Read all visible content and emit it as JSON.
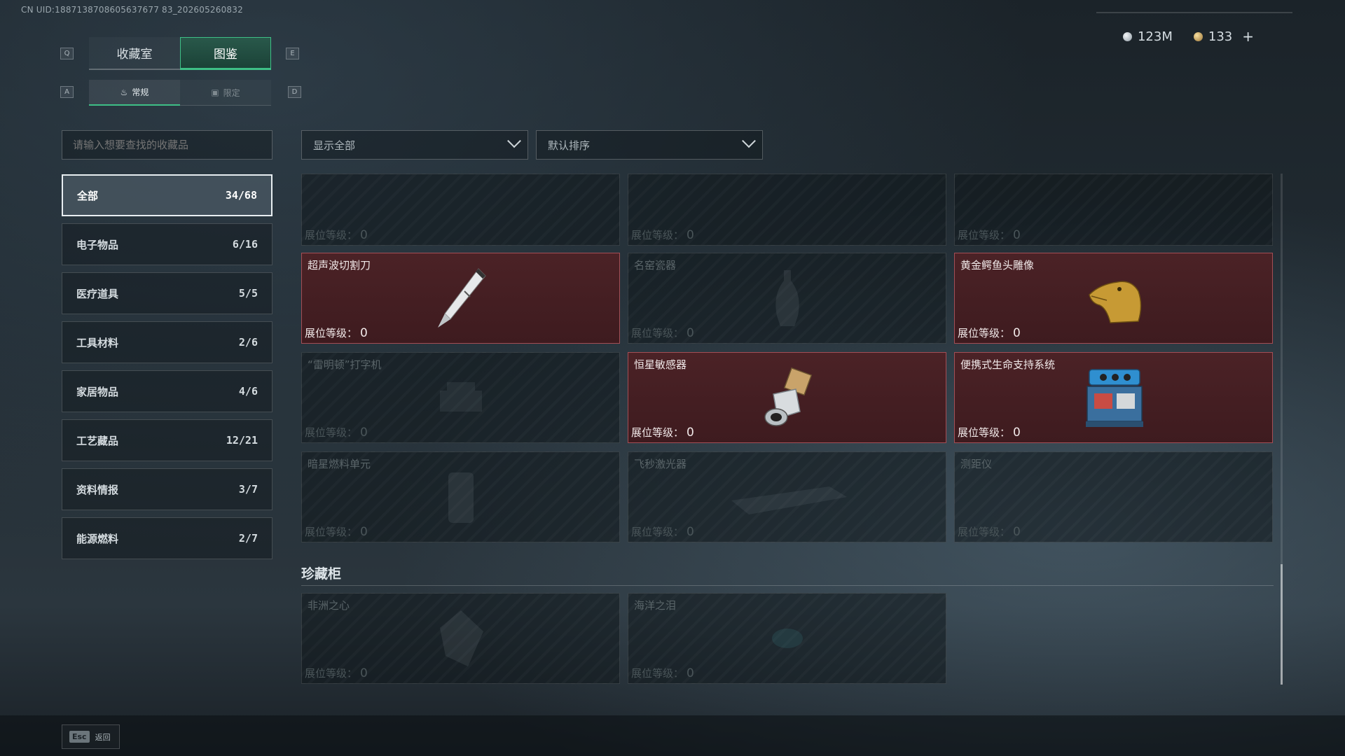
{
  "uid": "CN UID:1887138708605637677 83_202605260832",
  "currency": {
    "silver": "123M",
    "gold": "133",
    "plus": "+"
  },
  "keys": {
    "prev_tab": "Q",
    "next_tab": "E",
    "prev_sub": "A",
    "next_sub": "D"
  },
  "tabs": [
    {
      "label": "收藏室"
    },
    {
      "label": "图鉴"
    }
  ],
  "subtabs": [
    {
      "label": "常规"
    },
    {
      "label": "限定"
    }
  ],
  "search": {
    "placeholder": "请输入想要查找的收藏品"
  },
  "categories": [
    {
      "label": "全部",
      "count": "34/68"
    },
    {
      "label": "电子物品",
      "count": "6/16"
    },
    {
      "label": "医疗道具",
      "count": "5/5"
    },
    {
      "label": "工具材料",
      "count": "2/6"
    },
    {
      "label": "家居物品",
      "count": "4/6"
    },
    {
      "label": "工艺藏品",
      "count": "12/21"
    },
    {
      "label": "资料情报",
      "count": "3/7"
    },
    {
      "label": "能源燃料",
      "count": "2/7"
    }
  ],
  "filters": {
    "show": "显示全部",
    "sort": "默认排序"
  },
  "level_label": "展位等级：",
  "items": [
    {
      "name": "",
      "level": "0",
      "owned": false
    },
    {
      "name": "",
      "level": "0",
      "owned": false
    },
    {
      "name": "",
      "level": "0",
      "owned": false
    },
    {
      "name": "超声波切割刀",
      "level": "0",
      "owned": true
    },
    {
      "name": "名窑瓷器",
      "level": "0",
      "owned": false
    },
    {
      "name": "黄金鳄鱼头雕像",
      "level": "0",
      "owned": true
    },
    {
      "name": "“雷明顿”打字机",
      "level": "0",
      "owned": false
    },
    {
      "name": "恒星敏感器",
      "level": "0",
      "owned": true
    },
    {
      "name": "便携式生命支持系统",
      "level": "0",
      "owned": true
    },
    {
      "name": "暗星燃料单元",
      "level": "0",
      "owned": false
    },
    {
      "name": "飞秒激光器",
      "level": "0",
      "owned": false
    },
    {
      "name": "测距仪",
      "level": "0",
      "owned": false
    }
  ],
  "cabinet": {
    "title": "珍藏柜",
    "items": [
      {
        "name": "非洲之心",
        "level": "0",
        "owned": false
      },
      {
        "name": "海洋之泪",
        "level": "0",
        "owned": false
      }
    ]
  },
  "footer": {
    "esc_key": "Esc",
    "back_label": "返回"
  }
}
